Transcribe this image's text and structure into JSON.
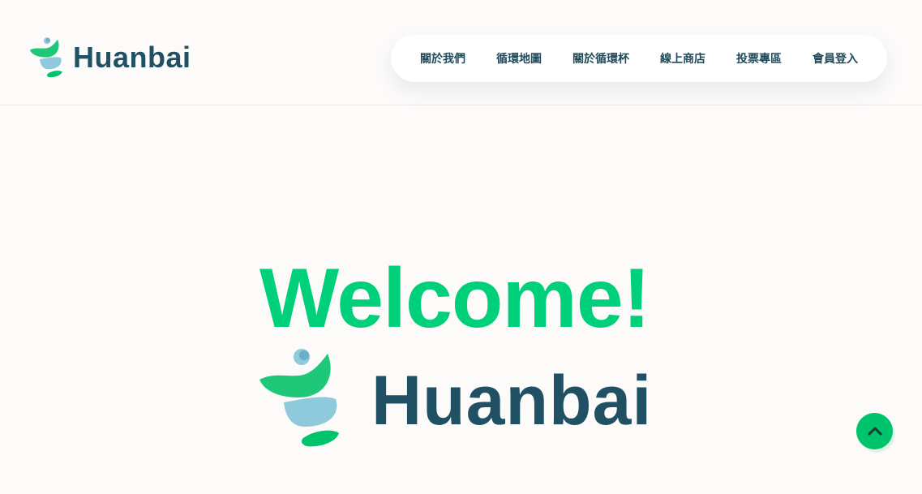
{
  "brand": {
    "name": "Huanbai"
  },
  "nav": {
    "items": [
      {
        "label": "關於我們"
      },
      {
        "label": "循環地圖"
      },
      {
        "label": "關於循環杯"
      },
      {
        "label": "線上商店"
      },
      {
        "label": "投票專區"
      },
      {
        "label": "會員登入"
      }
    ]
  },
  "hero": {
    "headline": "Welcome!",
    "brand_name": "Huanbai"
  },
  "icons": {
    "back_to_top": "chevron-up-icon",
    "logo": "huanbai-logo-icon"
  },
  "colors": {
    "accent_green": "#00d07a",
    "brand_navy": "#1f5064",
    "background": "#fdfbfa"
  }
}
